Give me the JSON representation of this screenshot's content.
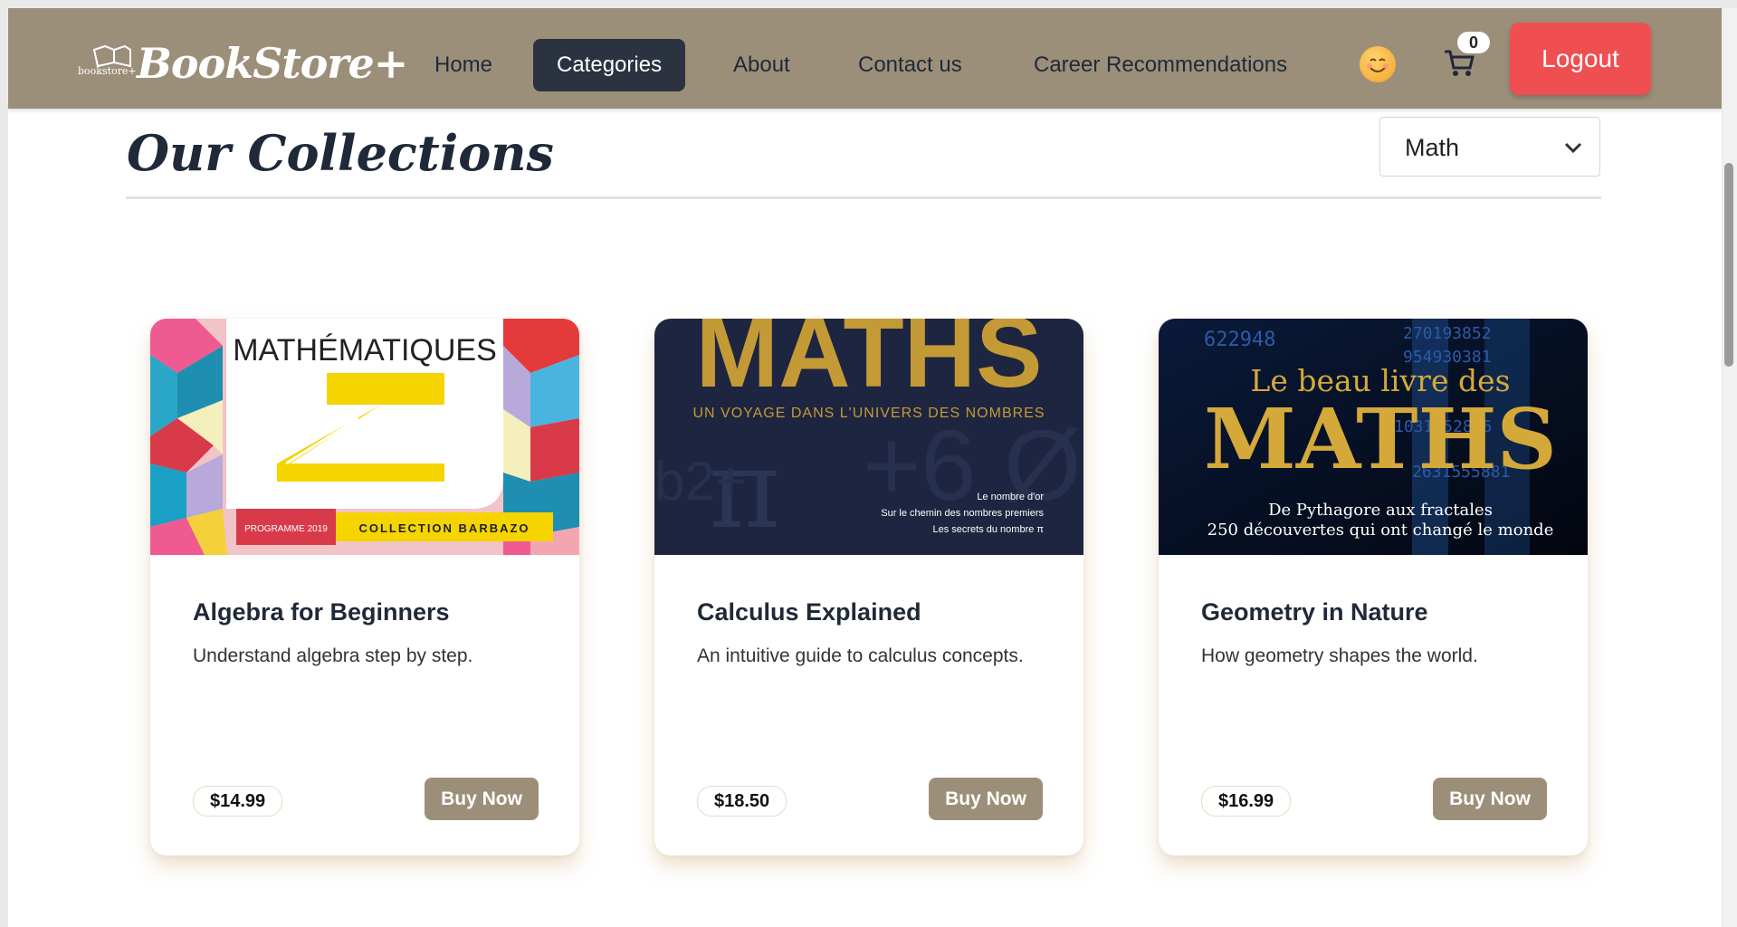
{
  "brand": {
    "name": "BookStore+",
    "mini_label": "bookstore+"
  },
  "nav": {
    "items": [
      {
        "label": "Home",
        "active": false
      },
      {
        "label": "Categories",
        "active": true
      },
      {
        "label": "About",
        "active": false
      },
      {
        "label": "Contact us",
        "active": false
      },
      {
        "label": "Career Recommendations",
        "active": false
      }
    ],
    "cart_count": "0",
    "logout_label": "Logout",
    "avatar_icon": "smiling-face-emoji",
    "cart_icon": "cart-icon"
  },
  "collections": {
    "title": "Our Collections",
    "category_select": {
      "value": "Math"
    }
  },
  "books": [
    {
      "title": "Algebra for Beginners",
      "description": "Understand algebra step by step.",
      "price": "$14.99",
      "buy_label": "Buy Now",
      "cover": {
        "title": "MATHÉMATIQUES",
        "badge": "PROGRAMME 2019",
        "collection": "COLLECTION BARBAZO"
      }
    },
    {
      "title": "Calculus Explained",
      "description": "An intuitive guide to calculus concepts.",
      "price": "$18.50",
      "buy_label": "Buy Now",
      "cover": {
        "title": "MATHS",
        "subtitle": "UN VOYAGE DANS L'UNIVERS DES NOMBRES",
        "lines": [
          "Le nombre d'or",
          "Sur le chemin des nombres premiers",
          "Les secrets du nombre π"
        ]
      }
    },
    {
      "title": "Geometry in Nature",
      "description": "How geometry shapes the world.",
      "price": "$16.99",
      "buy_label": "Buy Now",
      "cover": {
        "title_top": "Le beau livre des",
        "title": "MATHS",
        "line1": "De Pythagore aux fractales",
        "line2": "250 découvertes qui ont changé le monde"
      }
    }
  ],
  "colors": {
    "nav_bg": "#9c8f7a",
    "active_tab": "#2b3240",
    "logout": "#ef4f50",
    "buy": "#9c8f7a"
  }
}
